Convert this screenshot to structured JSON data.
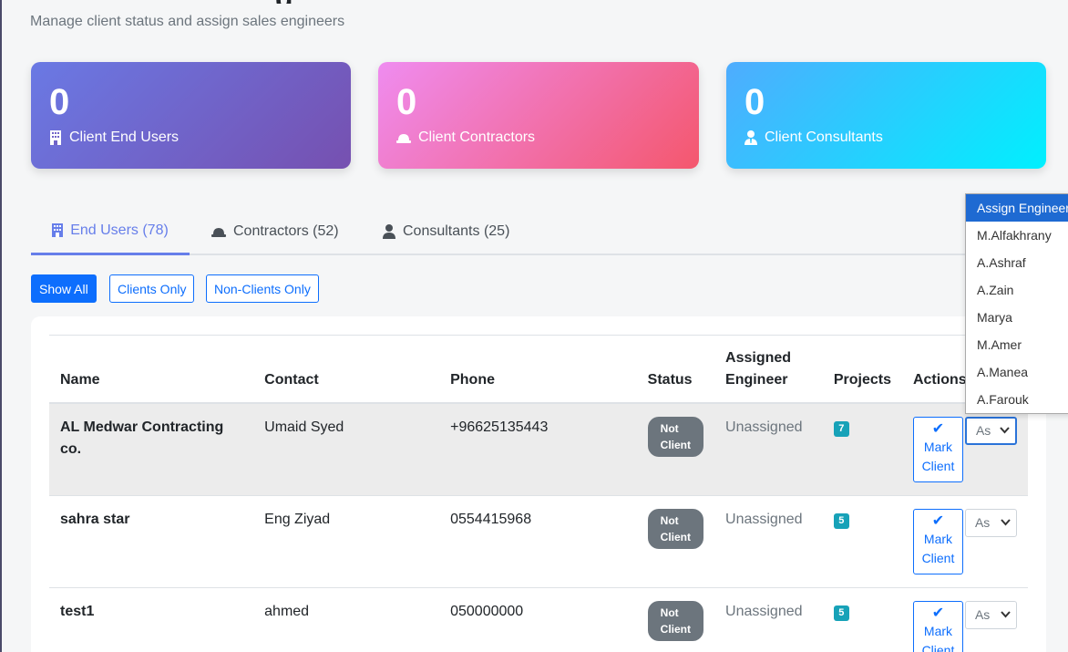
{
  "header": {
    "title_fragment": "g",
    "subtitle": "Manage client status and assign sales engineers"
  },
  "stats": [
    {
      "value": "0",
      "label": "Client End Users",
      "icon": "building-icon"
    },
    {
      "value": "0",
      "label": "Client Contractors",
      "icon": "hard-hat-icon"
    },
    {
      "value": "0",
      "label": "Client Consultants",
      "icon": "user-tie-icon"
    }
  ],
  "tabs": [
    {
      "label": "End Users (78)",
      "active": true
    },
    {
      "label": "Contractors (52)",
      "active": false
    },
    {
      "label": "Consultants (25)",
      "active": false
    }
  ],
  "filters": {
    "show_all": "Show All",
    "clients_only": "Clients Only",
    "non_clients_only": "Non-Clients Only"
  },
  "table": {
    "columns": {
      "name": "Name",
      "contact": "Contact",
      "phone": "Phone",
      "status": "Status",
      "engineer_line1": "Assigned",
      "engineer_line2": "Engineer",
      "projects": "Projects",
      "actions": "Actions"
    },
    "rows": [
      {
        "name": "AL Medwar Contracting co.",
        "contact": "Umaid Syed",
        "phone": "+96625135443",
        "status_line1": "Not",
        "status_line2": "Client",
        "engineer": "Unassigned",
        "projects": "7",
        "mark_line1": "Mark",
        "mark_line2": "Client",
        "select_value": "As"
      },
      {
        "name": "sahra star",
        "contact": "Eng Ziyad",
        "phone": "0554415968",
        "status_line1": "Not",
        "status_line2": "Client",
        "engineer": "Unassigned",
        "projects": "5",
        "mark_line1": "Mark",
        "mark_line2": "Client",
        "select_value": "As"
      },
      {
        "name": "test1",
        "contact": "ahmed",
        "phone": "050000000",
        "status_line1": "Not",
        "status_line2": "Client",
        "engineer": "Unassigned",
        "projects": "5",
        "mark_line1": "Mark",
        "mark_line2": "Client",
        "select_value": "As"
      }
    ]
  },
  "engineer_dropdown": {
    "options": [
      "Assign Engineer...",
      "M.Alfakhrany",
      "A.Ashraf",
      "A.Zain",
      "Marya",
      "M.Amer",
      "A.Manea",
      "A.Farouk"
    ],
    "selected_index": 0
  },
  "colors": {
    "primary": "#0d6efd",
    "tab_active": "#667eea",
    "badge_status": "#6c757d",
    "badge_projects": "#17a2b8"
  }
}
